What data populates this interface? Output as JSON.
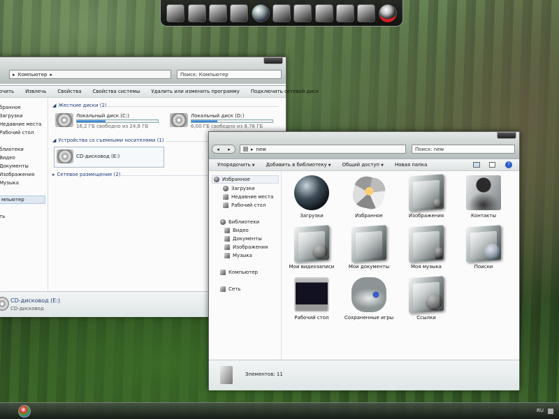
{
  "dock": {
    "icons": [
      "display-icon",
      "network-icon",
      "camera-icon",
      "gamepad-icon",
      "globe-icon",
      "panel-icon",
      "tools-icon",
      "printer-icon",
      "media-icon",
      "computer-icon",
      "user-icon"
    ]
  },
  "left_window": {
    "address": "Компьютер",
    "search_placeholder": "Поиск: Компьютер",
    "toolbar": [
      "очить",
      "Извлечь",
      "Свойства",
      "Свойства системы",
      "Удалить или изменить программу",
      "Подключить сетевой диск"
    ],
    "sidebar": [
      "бранное",
      "Загрузки",
      "Недавние места",
      "Рабочий стол",
      "блиотеки",
      "Видео",
      "Документы",
      "Изображения",
      "Музыка",
      "мпьютер",
      "ть"
    ],
    "hard_disks_header": "Жесткие диски (2)",
    "removable_header": "Устройства со съемными носителями (1)",
    "network_header": "Сетевое размещение (2)",
    "drives": [
      {
        "name": "Локальный диск (C:)",
        "free": "16,2 ГБ свободно из 24,8 ГБ",
        "used_fraction": 0.35
      },
      {
        "name": "Локальный диск (D:)",
        "free": "6,00 ГБ свободно из 8,78 ГБ",
        "used_fraction": 0.32
      }
    ],
    "cd": {
      "name": "CD-дисковод (E:)"
    },
    "status": {
      "title": "CD-дисковод (E:)",
      "subtitle": "CD-дисковод"
    }
  },
  "right_window": {
    "address": "new",
    "search_placeholder": "Поиск: new",
    "toolbar": {
      "organize": "Упорядочить",
      "add_library": "Добавить в библиотеку",
      "share": "Общий доступ",
      "new_folder": "Новая папка"
    },
    "sidebar": {
      "favorites": "Избранное",
      "downloads": "Загрузки",
      "recent": "Недавние места",
      "desktop": "Рабочий стол",
      "libraries": "Библиотеки",
      "video": "Видео",
      "documents": "Документы",
      "pictures": "Изображения",
      "music": "Музыка",
      "computer": "Компьютер",
      "network": "Сеть"
    },
    "items": [
      {
        "label": "Загрузки",
        "icon": "downloads-icon"
      },
      {
        "label": "Избранное",
        "icon": "favorites-icon"
      },
      {
        "label": "Изображения",
        "icon": "pictures-icon"
      },
      {
        "label": "Контакты",
        "icon": "contacts-icon"
      },
      {
        "label": "Мои видеозаписи",
        "icon": "videos-icon"
      },
      {
        "label": "Мои документы",
        "icon": "documents-icon"
      },
      {
        "label": "Моя музыка",
        "icon": "music-icon"
      },
      {
        "label": "Поиски",
        "icon": "searches-icon"
      },
      {
        "label": "Рабочий стол",
        "icon": "desktop-icon"
      },
      {
        "label": "Сохраненные игры",
        "icon": "saved-games-icon"
      },
      {
        "label": "Ссылки",
        "icon": "links-icon"
      }
    ],
    "status": "Элементов: 11"
  },
  "taskbar": {
    "language": "RU"
  }
}
